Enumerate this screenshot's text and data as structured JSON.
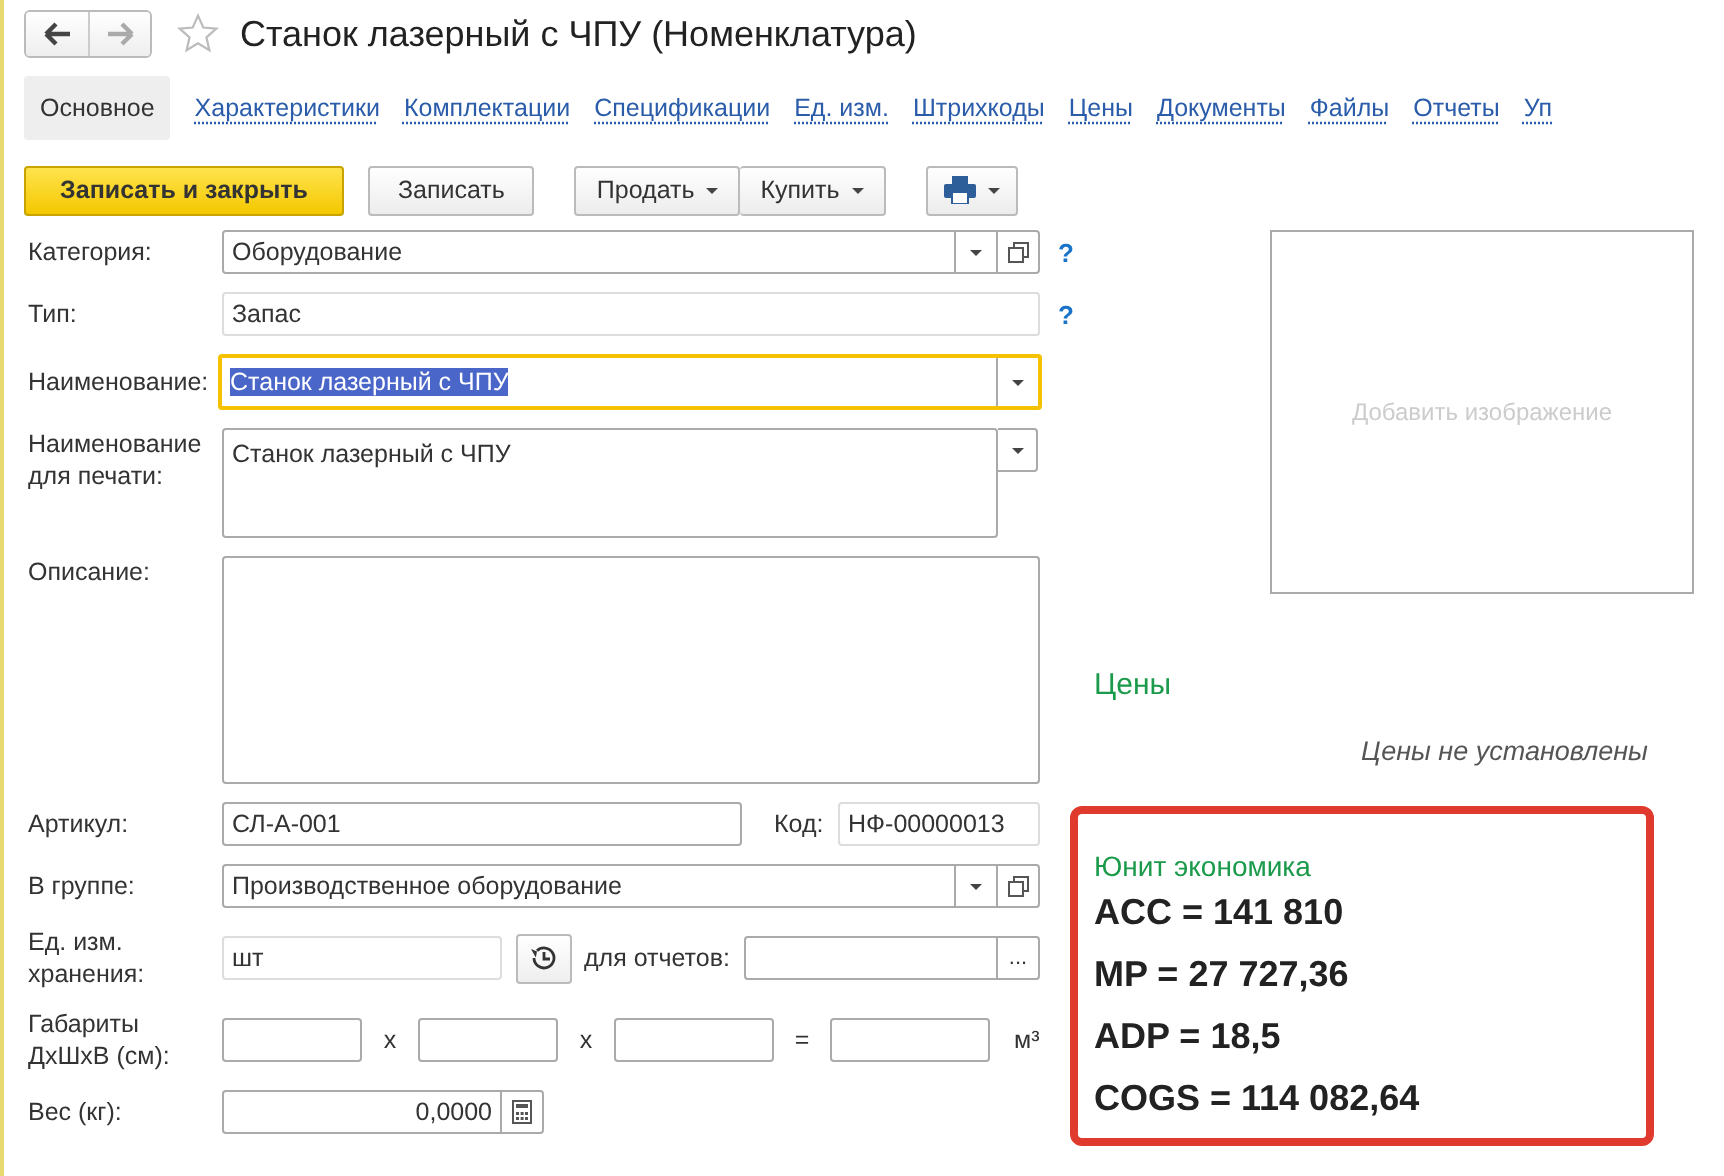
{
  "header": {
    "favorite": false,
    "title": "Станок лазерный с ЧПУ (Номенклатура)"
  },
  "tabs": [
    {
      "label": "Основное",
      "selected": true
    },
    {
      "label": "Характеристики",
      "selected": false
    },
    {
      "label": "Комплектации",
      "selected": false
    },
    {
      "label": "Спецификации",
      "selected": false
    },
    {
      "label": "Ед. изм.",
      "selected": false
    },
    {
      "label": "Штрихкоды",
      "selected": false
    },
    {
      "label": "Цены",
      "selected": false
    },
    {
      "label": "Документы",
      "selected": false
    },
    {
      "label": "Файлы",
      "selected": false
    },
    {
      "label": "Отчеты",
      "selected": false
    },
    {
      "label": "Уп",
      "selected": false
    }
  ],
  "toolbar": [
    {
      "kind": "primary",
      "label": "Записать и закрыть"
    },
    {
      "kind": "plain",
      "label": "Записать"
    },
    {
      "kind": "split",
      "items": [
        "Продать",
        "Купить"
      ]
    },
    {
      "kind": "print"
    }
  ],
  "form": {
    "category": {
      "label": "Категория:",
      "value": "Оборудование",
      "help": "?"
    },
    "type": {
      "label": "Тип:",
      "value": "Запас",
      "help": "?"
    },
    "name": {
      "label": "Наименование:",
      "value": "Станок лазерный с ЧПУ",
      "focused": true
    },
    "print_name": {
      "label": "Наименование для печати:",
      "value": "Станок лазерный с ЧПУ"
    },
    "description": {
      "label": "Описание:"
    },
    "article": {
      "label": "Артикул:",
      "value": "СЛ-А-001"
    },
    "code": {
      "label": "Код:",
      "value": "НФ-00000013"
    },
    "group": {
      "label": "В группе:",
      "value": "Производственное оборудование"
    },
    "unit": {
      "label": "Ед. изм. хранения:",
      "value": "шт",
      "report_label": "для отчетов:",
      "more": "..."
    },
    "dimensions": {
      "label": "Габариты ДхШхВ (см):",
      "operators": [
        "x",
        "x",
        "="
      ],
      "unit": "м³"
    },
    "weight": {
      "label": "Вес (кг):",
      "value": "0,0000"
    }
  },
  "image": {
    "placeholder": "Добавить изображение"
  },
  "prices": {
    "title": "Цены",
    "note": "Цены не установлены"
  },
  "unit_economics": {
    "title": "Юнит экономика",
    "lines": [
      "ACC = 141 810",
      "MP = 27 727,36",
      "ADP = 18,5",
      "COGS = 114 082,64"
    ]
  }
}
